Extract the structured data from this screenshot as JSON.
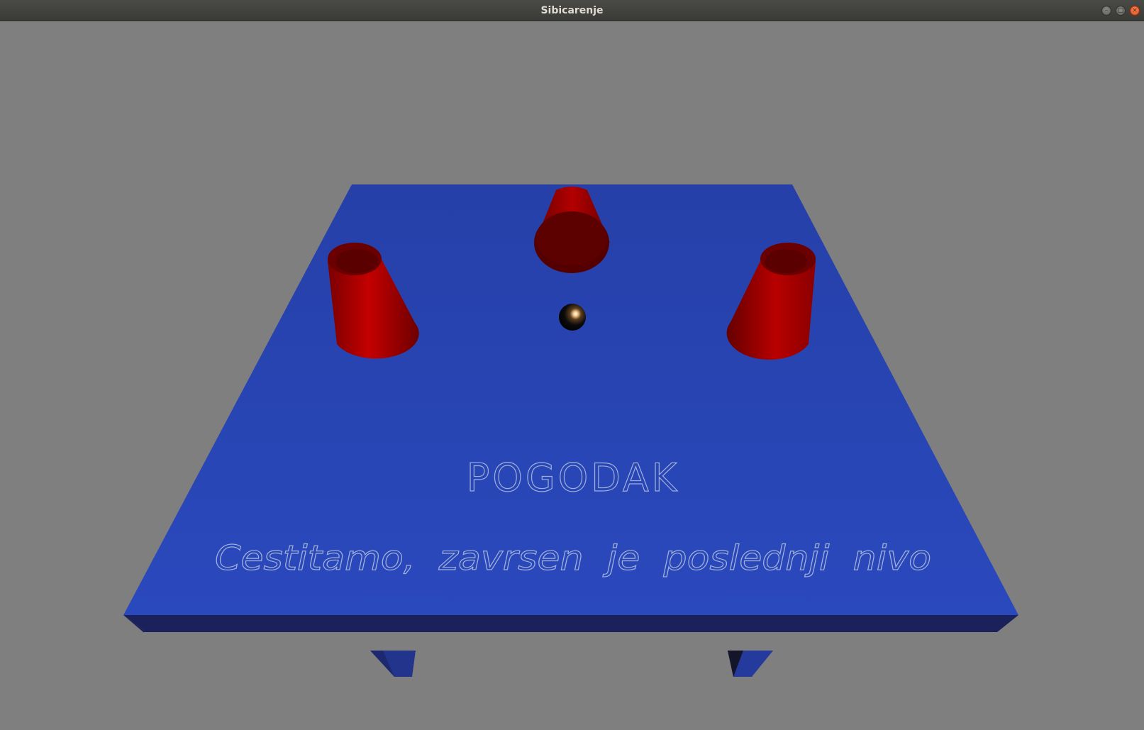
{
  "window": {
    "title": "Sibicarenje",
    "controls": {
      "minimize": "–",
      "maximize": "□",
      "close": "×"
    }
  },
  "game": {
    "status_text": "POGODAK",
    "message_text": "Cestitamo,  zavrsen  je  poslednji  nivo",
    "cups_count": 3,
    "colors": {
      "background": "#7f7f7f",
      "table_top": "#2847b3",
      "table_edge": "#1c2158",
      "cup": "#b30000",
      "ball": "#000000",
      "text": "#9fb0d8"
    }
  }
}
